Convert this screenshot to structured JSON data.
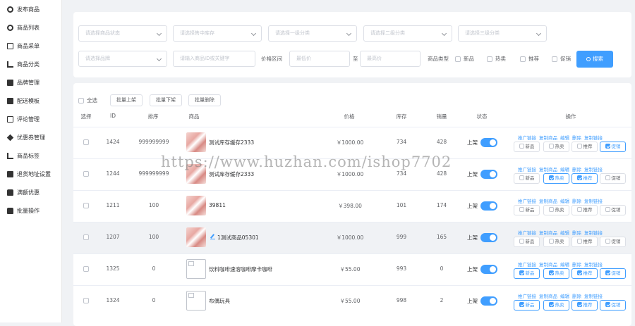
{
  "sidebar": {
    "items": [
      {
        "label": "发布商品",
        "icon": "gear-icon"
      },
      {
        "label": "商品列表",
        "icon": "gear-icon"
      },
      {
        "label": "商品采单",
        "icon": "document-icon"
      },
      {
        "label": "商品分类",
        "icon": "tree-icon"
      },
      {
        "label": "品牌管理",
        "icon": "list-icon"
      },
      {
        "label": "配送模板",
        "icon": "truck-icon"
      },
      {
        "label": "评论管理",
        "icon": "comment-icon"
      },
      {
        "label": "优惠券管理",
        "icon": "tag-icon"
      },
      {
        "label": "商品标签",
        "icon": "tree-icon"
      },
      {
        "label": "退货地址设置",
        "icon": "truck-icon"
      },
      {
        "label": "满额优惠",
        "icon": "bag-icon"
      },
      {
        "label": "批量操作",
        "icon": "bag-icon"
      }
    ]
  },
  "filters": {
    "status_placeholder": "请选择商品状态",
    "stock_placeholder": "请选择售中库存",
    "cat1_placeholder": "请选择一级分类",
    "cat2_placeholder": "请选择二级分类",
    "cat3_placeholder": "请选择三级分类",
    "brand_placeholder": "请选择品牌",
    "keyword_placeholder": "请输入商品ID或关键字",
    "price_label": "价格区间",
    "price_min_placeholder": "最低价",
    "price_to": "至",
    "price_max_placeholder": "最高价",
    "type_label": "商品类型",
    "type_new": "新品",
    "type_hot": "热卖",
    "type_rec": "推荐",
    "type_promo": "促销",
    "search_label": "搜索"
  },
  "bulk": {
    "select_all": "全选",
    "on_shelf": "批量上架",
    "off_shelf": "批量下架",
    "delete": "批量删除"
  },
  "table": {
    "headers": {
      "select": "选择",
      "id": "ID",
      "sort": "排序",
      "product": "商品",
      "price": "价格",
      "stock": "库存",
      "sales": "销量",
      "status": "状态",
      "actions": "操作"
    },
    "actions": [
      "推广链接",
      "复制商品",
      "编辑",
      "删除",
      "复制链接"
    ],
    "flags": [
      "新品",
      "热卖",
      "推荐",
      "促销"
    ],
    "status_on": "上架",
    "rows": [
      {
        "id": "1424",
        "sort": "999999999",
        "name": "测试库存缓存2333",
        "price": "￥1000.00",
        "stock": "734",
        "sales": "428",
        "flags": [
          false,
          false,
          false,
          true
        ],
        "image": "photo"
      },
      {
        "id": "1244",
        "sort": "999999999",
        "name": "测试库存缓存2333",
        "price": "￥1000.00",
        "stock": "734",
        "sales": "428",
        "flags": [
          false,
          true,
          true,
          false
        ],
        "image": "photo"
      },
      {
        "id": "1211",
        "sort": "100",
        "name": "39811",
        "price": "￥398.00",
        "stock": "101",
        "sales": "174",
        "flags": [
          false,
          false,
          false,
          false
        ],
        "image": "photo"
      },
      {
        "id": "1207",
        "sort": "100",
        "name": "1测试商品05301",
        "price": "￥1000.00",
        "stock": "999",
        "sales": "165",
        "flags": [
          false,
          false,
          false,
          false
        ],
        "image": "photo"
      },
      {
        "id": "1325",
        "sort": "0",
        "name": "饮料咖啡速溶咖啡摩卡咖啡",
        "price": "￥55.00",
        "stock": "993",
        "sales": "0",
        "flags": [
          true,
          true,
          true,
          true
        ],
        "image": "broken"
      },
      {
        "id": "1324",
        "sort": "0",
        "name": "布偶玩具",
        "price": "￥55.00",
        "stock": "998",
        "sales": "2",
        "flags": [
          true,
          true,
          true,
          true
        ],
        "image": "broken"
      }
    ]
  },
  "watermark": "https://www.huzhan.com/ishop7702",
  "colors": {
    "accent": "#409eff",
    "background": "#f0f2f5"
  }
}
